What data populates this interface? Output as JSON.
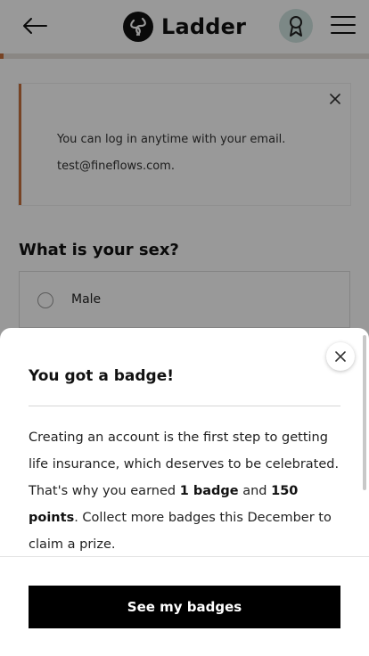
{
  "header": {
    "brand": "Ladder",
    "icons": {
      "back": "arrow-left-icon",
      "badge": "award-ribbon-icon",
      "menu": "hamburger-menu-icon",
      "logo": "ladder-logo-mark"
    }
  },
  "progress": {
    "fraction": 0.01,
    "color": "#c6703c"
  },
  "notice": {
    "line1": "You can log in anytime with your email.",
    "line2": "test@fineflows.com."
  },
  "question": {
    "title": "What is your sex?",
    "options": [
      {
        "label": "Male"
      }
    ]
  },
  "modal": {
    "title": "You got a badge!",
    "body": {
      "part1": "Creating an account is the first step to getting life insurance, which deserves to be celebrated. That's why you earned ",
      "badge_count": "1 badge",
      "part2": " and ",
      "points": "150 points",
      "part3": ". Collect more badges this December to claim a prize."
    },
    "cta_label": "See my badges"
  },
  "colors": {
    "accent": "#c6703c",
    "badge_bg": "#cfe3e0",
    "cta_bg": "#000000"
  }
}
